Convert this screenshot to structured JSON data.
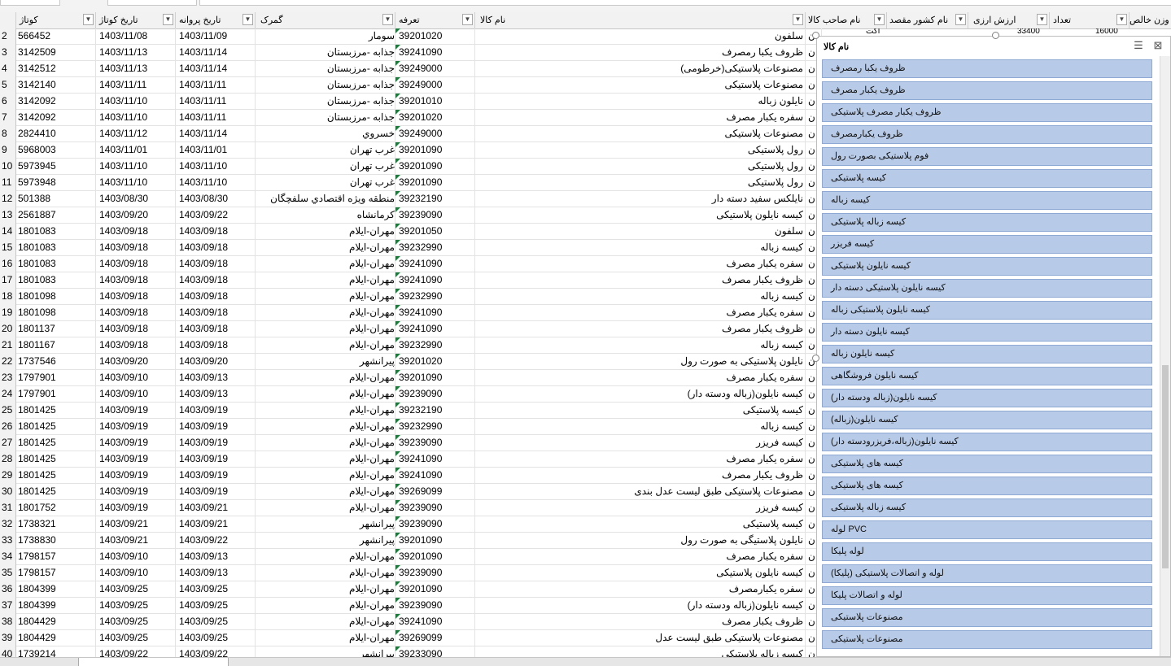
{
  "headers": {
    "kotaj": "کوتاژ",
    "tarikh_kotaj": "تاریخ کوتاژ",
    "tarikh_parvane": "تاریخ پروانه",
    "gomrok": "گمرک",
    "tarefe": "تعرفه",
    "name_kala": "نام کالا",
    "name_saheb_kala": "نام صاحب کالا",
    "name_keshvar": "نام کشور مقصد",
    "arzesh_arzi": "ارزش ارزی",
    "tedad": "تعداد",
    "vazn": "وزن خالص",
    "filter_glyph": "▼"
  },
  "partial_values": {
    "owner_peek": "آکت",
    "tedad_peek": "33400",
    "vazn_peek": "16000"
  },
  "rows": [
    {
      "n": "2",
      "kotaj": "566452",
      "t1": "1403/11/08",
      "t2": "1403/11/09",
      "gomrok": "سومار",
      "tarefe": "39201020",
      "kala": "سلفون",
      "own": "ن"
    },
    {
      "n": "3",
      "kotaj": "3142509",
      "t1": "1403/11/13",
      "t2": "1403/11/14",
      "gomrok": "جذابه -مرزبستان",
      "tarefe": "39241090",
      "kala": "ظروف یکبا رمصرف",
      "own": "ن"
    },
    {
      "n": "4",
      "kotaj": "3142512",
      "t1": "1403/11/13",
      "t2": "1403/11/14",
      "gomrok": "جذابه -مرزبستان",
      "tarefe": "39249000",
      "kala": "مصنوعات پلاستیکی(خرطومی)",
      "own": "ن"
    },
    {
      "n": "5",
      "kotaj": "3142140",
      "t1": "1403/11/11",
      "t2": "1403/11/11",
      "gomrok": "جذابه -مرزبستان",
      "tarefe": "39249000",
      "kala": "مصنوعات پلاستیکی",
      "own": "ن"
    },
    {
      "n": "6",
      "kotaj": "3142092",
      "t1": "1403/11/10",
      "t2": "1403/11/11",
      "gomrok": "جذابه -مرزبستان",
      "tarefe": "39201010",
      "kala": "نایلون زباله",
      "own": "ن"
    },
    {
      "n": "7",
      "kotaj": "3142092",
      "t1": "1403/11/10",
      "t2": "1403/11/11",
      "gomrok": "جذابه -مرزبستان",
      "tarefe": "39201020",
      "kala": "سفره یکبار مصرف",
      "own": "ن"
    },
    {
      "n": "8",
      "kotaj": "2824410",
      "t1": "1403/11/12",
      "t2": "1403/11/14",
      "gomrok": "خسروي",
      "tarefe": "39249000",
      "kala": "مصنوعات پلاستیکی",
      "own": "ن"
    },
    {
      "n": "9",
      "kotaj": "5968003",
      "t1": "1403/11/01",
      "t2": "1403/11/01",
      "gomrok": "غرب تهران",
      "tarefe": "39201090",
      "kala": "رول پلاستیکی",
      "own": "ن"
    },
    {
      "n": "10",
      "kotaj": "5973945",
      "t1": "1403/11/10",
      "t2": "1403/11/10",
      "gomrok": "غرب تهران",
      "tarefe": "39201090",
      "kala": "رول پلاستیکی",
      "own": "ن"
    },
    {
      "n": "11",
      "kotaj": "5973948",
      "t1": "1403/11/10",
      "t2": "1403/11/10",
      "gomrok": "غرب تهران",
      "tarefe": "39201090",
      "kala": "رول پلاستیکی",
      "own": "ن"
    },
    {
      "n": "12",
      "kotaj": "501388",
      "t1": "1403/08/30",
      "t2": "1403/08/30",
      "gomrok": "منطقه ویژه اقتصادي سلفچگان",
      "tarefe": "39232190",
      "kala": "نایلکس سفید دسته دار",
      "own": "ن"
    },
    {
      "n": "13",
      "kotaj": "2561887",
      "t1": "1403/09/20",
      "t2": "1403/09/22",
      "gomrok": "کرمانشاه",
      "tarefe": "39239090",
      "kala": "کیسه نایلون پلاستیکی",
      "own": "ن"
    },
    {
      "n": "14",
      "kotaj": "1801083",
      "t1": "1403/09/18",
      "t2": "1403/09/18",
      "gomrok": "مهران-ایلام",
      "tarefe": "39201050",
      "kala": "سلفون",
      "own": "ن"
    },
    {
      "n": "15",
      "kotaj": "1801083",
      "t1": "1403/09/18",
      "t2": "1403/09/18",
      "gomrok": "مهران-ایلام",
      "tarefe": "39232990",
      "kala": "کیسه زباله",
      "own": "ن"
    },
    {
      "n": "16",
      "kotaj": "1801083",
      "t1": "1403/09/18",
      "t2": "1403/09/18",
      "gomrok": "مهران-ایلام",
      "tarefe": "39241090",
      "kala": "سفره یکبار مصرف",
      "own": "ن"
    },
    {
      "n": "17",
      "kotaj": "1801083",
      "t1": "1403/09/18",
      "t2": "1403/09/18",
      "gomrok": "مهران-ایلام",
      "tarefe": "39241090",
      "kala": "ظروف یکبار مصرف",
      "own": "ن"
    },
    {
      "n": "18",
      "kotaj": "1801098",
      "t1": "1403/09/18",
      "t2": "1403/09/18",
      "gomrok": "مهران-ایلام",
      "tarefe": "39232990",
      "kala": "کیسه زباله",
      "own": "ن"
    },
    {
      "n": "19",
      "kotaj": "1801098",
      "t1": "1403/09/18",
      "t2": "1403/09/18",
      "gomrok": "مهران-ایلام",
      "tarefe": "39241090",
      "kala": "سفره یکبار مصرف",
      "own": "ن"
    },
    {
      "n": "20",
      "kotaj": "1801137",
      "t1": "1403/09/18",
      "t2": "1403/09/18",
      "gomrok": "مهران-ایلام",
      "tarefe": "39241090",
      "kala": "ظروف یکبار مصرف",
      "own": "ن"
    },
    {
      "n": "21",
      "kotaj": "1801167",
      "t1": "1403/09/18",
      "t2": "1403/09/18",
      "gomrok": "مهران-ایلام",
      "tarefe": "39232990",
      "kala": "کیسه زباله",
      "own": "ن"
    },
    {
      "n": "22",
      "kotaj": "1737546",
      "t1": "1403/09/20",
      "t2": "1403/09/20",
      "gomrok": "پیرانشهر",
      "tarefe": "39201020",
      "kala": "نایلون پلاستیکی به صورت رول",
      "own": "ن"
    },
    {
      "n": "23",
      "kotaj": "1797901",
      "t1": "1403/09/10",
      "t2": "1403/09/13",
      "gomrok": "مهران-ایلام",
      "tarefe": "39201090",
      "kala": "سفره یکبار مصرف",
      "own": "ن"
    },
    {
      "n": "24",
      "kotaj": "1797901",
      "t1": "1403/09/10",
      "t2": "1403/09/13",
      "gomrok": "مهران-ایلام",
      "tarefe": "39239090",
      "kala": "کیسه نایلون(زباله ودسته دار)",
      "own": "ن"
    },
    {
      "n": "25",
      "kotaj": "1801425",
      "t1": "1403/09/19",
      "t2": "1403/09/19",
      "gomrok": "مهران-ایلام",
      "tarefe": "39232190",
      "kala": "کیسه پلاستیکی",
      "own": "ن"
    },
    {
      "n": "26",
      "kotaj": "1801425",
      "t1": "1403/09/19",
      "t2": "1403/09/19",
      "gomrok": "مهران-ایلام",
      "tarefe": "39232990",
      "kala": "کیسه زباله",
      "own": "ن"
    },
    {
      "n": "27",
      "kotaj": "1801425",
      "t1": "1403/09/19",
      "t2": "1403/09/19",
      "gomrok": "مهران-ایلام",
      "tarefe": "39239090",
      "kala": "کیسه فریزر",
      "own": "ن"
    },
    {
      "n": "28",
      "kotaj": "1801425",
      "t1": "1403/09/19",
      "t2": "1403/09/19",
      "gomrok": "مهران-ایلام",
      "tarefe": "39241090",
      "kala": "سفره یکبار مصرف",
      "own": "ن"
    },
    {
      "n": "29",
      "kotaj": "1801425",
      "t1": "1403/09/19",
      "t2": "1403/09/19",
      "gomrok": "مهران-ایلام",
      "tarefe": "39241090",
      "kala": "ظروف یکبار مصرف",
      "own": "ن"
    },
    {
      "n": "30",
      "kotaj": "1801425",
      "t1": "1403/09/19",
      "t2": "1403/09/19",
      "gomrok": "مهران-ایلام",
      "tarefe": "39269099",
      "kala": "مصنوعات پلاستیکی طبق لیست عدل بندی",
      "own": "ن"
    },
    {
      "n": "31",
      "kotaj": "1801752",
      "t1": "1403/09/19",
      "t2": "1403/09/21",
      "gomrok": "مهران-ایلام",
      "tarefe": "39239090",
      "kala": "کیسه فریزر",
      "own": "ن"
    },
    {
      "n": "32",
      "kotaj": "1738321",
      "t1": "1403/09/21",
      "t2": "1403/09/21",
      "gomrok": "پیرانشهر",
      "tarefe": "39239090",
      "kala": "کیسه پلاستیکی",
      "own": "ن"
    },
    {
      "n": "33",
      "kotaj": "1738830",
      "t1": "1403/09/21",
      "t2": "1403/09/22",
      "gomrok": "پیرانشهر",
      "tarefe": "39201090",
      "kala": "نایلون پلاستیگی به صورت رول",
      "own": "ن"
    },
    {
      "n": "34",
      "kotaj": "1798157",
      "t1": "1403/09/10",
      "t2": "1403/09/13",
      "gomrok": "مهران-ایلام",
      "tarefe": "39201090",
      "kala": "سفره یکبار مصرف",
      "own": "ن"
    },
    {
      "n": "35",
      "kotaj": "1798157",
      "t1": "1403/09/10",
      "t2": "1403/09/13",
      "gomrok": "مهران-ایلام",
      "tarefe": "39239090",
      "kala": "کیسه نایلون پلاستیکی",
      "own": "ن"
    },
    {
      "n": "36",
      "kotaj": "1804399",
      "t1": "1403/09/25",
      "t2": "1403/09/25",
      "gomrok": "مهران-ایلام",
      "tarefe": "39201090",
      "kala": "سفره یکبارمصرف",
      "own": "ن"
    },
    {
      "n": "37",
      "kotaj": "1804399",
      "t1": "1403/09/25",
      "t2": "1403/09/25",
      "gomrok": "مهران-ایلام",
      "tarefe": "39239090",
      "kala": "کیسه نایلون(زباله ودسته دار)",
      "own": "ن"
    },
    {
      "n": "38",
      "kotaj": "1804429",
      "t1": "1403/09/25",
      "t2": "1403/09/25",
      "gomrok": "مهران-ایلام",
      "tarefe": "39241090",
      "kala": "ظروف یکبار مصرف",
      "own": "ن"
    },
    {
      "n": "39",
      "kotaj": "1804429",
      "t1": "1403/09/25",
      "t2": "1403/09/25",
      "gomrok": "مهران-ایلام",
      "tarefe": "39269099",
      "kala": "مصنوعات پلاستیکی طبق لیست عدل",
      "own": "ن"
    },
    {
      "n": "40",
      "kotaj": "1739214",
      "t1": "1403/09/22",
      "t2": "1403/09/22",
      "gomrok": "پیرانشهر",
      "tarefe": "39233090",
      "kala": "کیسه زباله پلاستیکی",
      "own": "ن"
    }
  ],
  "slicer": {
    "title": "نام کالا",
    "multiselect_glyph": "☰",
    "clear_filter_glyph": "⊠",
    "items": [
      "ظروف یکبا رمصرف",
      "ظروف یکبار مصرف",
      "ظروف یکبار مصرف پلاستیکی",
      "ظروف یکبارمصرف",
      "فوم پلاستیکی بصورت رول",
      "کیسه پلاستیکی",
      "کیسه زباله",
      "کیسه زباله پلاستیکی",
      "کیسه فریزر",
      "کیسه نایلون پلاستیکی",
      "کیسه نایلون پلاستیکی دسته دار",
      "کیسه نایلون پلاستیکی زباله",
      "کیسه نایلون دسته دار",
      "کیسه نایلون زباله",
      "کیسه نایلون فروشگاهی",
      "کیسه نایلون(زباله ودسته دار)",
      "کیسه نایلون(زباله)",
      "کیسه نایلون(زباله،فریزرودسته دار)",
      "کیسه های  پلاستیکی",
      "کیسه های پلاستیکی",
      "کیسه زباله پلاستیکی",
      "لوله PVC",
      "لوله پلیکا",
      "لوله و اتصالات پلاستیکی (پلیکا)",
      "لوله و اتصالات پلیکا",
      "مصنوعات پلاستیکی",
      "مصنوعات پلاستیکی"
    ]
  },
  "colors": {
    "slicer_item_bg": "#b7cae7",
    "slicer_item_border": "#8ea9d4",
    "header_bg": "#f2f2f2",
    "grid_line": "#e3e3e3",
    "marker_green": "#1e7a3c"
  }
}
